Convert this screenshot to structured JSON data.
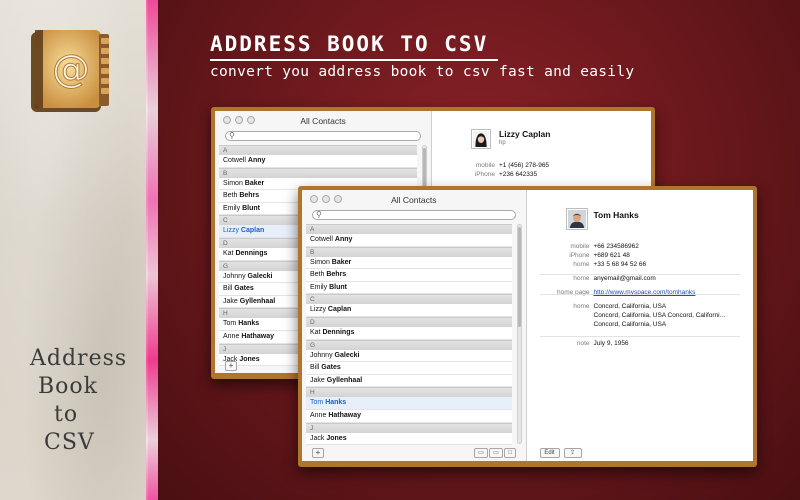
{
  "hero": {
    "title": "Address Book to CSV",
    "subtitle": "convert you address book to csv fast and easily"
  },
  "sidebar": {
    "title_lines": [
      "Address",
      "Book",
      "to",
      "CSV"
    ]
  },
  "back_window": {
    "title": "All Contacts",
    "contacts": [
      {
        "type": "header",
        "label": "A"
      },
      {
        "type": "contact",
        "first": "Cotwell",
        "last": "Anny"
      },
      {
        "type": "header",
        "label": "B"
      },
      {
        "type": "contact",
        "first": "Simon",
        "last": "Baker"
      },
      {
        "type": "contact",
        "first": "Beth",
        "last": "Behrs"
      },
      {
        "type": "contact",
        "first": "Emily",
        "last": "Blunt"
      },
      {
        "type": "header",
        "label": "C"
      },
      {
        "type": "contact",
        "first": "Lizzy",
        "last": "Caplan",
        "selected": true
      },
      {
        "type": "header",
        "label": "D"
      },
      {
        "type": "contact",
        "first": "Kat",
        "last": "Dennings"
      },
      {
        "type": "header",
        "label": "G"
      },
      {
        "type": "contact",
        "first": "Johnny",
        "last": "Galecki"
      },
      {
        "type": "contact",
        "first": "Bill",
        "last": "Gates"
      },
      {
        "type": "contact",
        "first": "Jake",
        "last": "Gyllenhaal"
      },
      {
        "type": "header",
        "label": "H"
      },
      {
        "type": "contact",
        "first": "Tom",
        "last": "Hanks"
      },
      {
        "type": "contact",
        "first": "Anne",
        "last": "Hathaway"
      },
      {
        "type": "header",
        "label": "J"
      },
      {
        "type": "contact",
        "first": "Jack",
        "last": "Jones"
      }
    ],
    "card": {
      "name": "Lizzy  Caplan",
      "sub": "hp",
      "fields": [
        {
          "label": "mobile",
          "value": "+1 (456) 278-965"
        },
        {
          "label": "iPhone",
          "value": "+236 642335"
        }
      ]
    },
    "add_label": "+"
  },
  "front_window": {
    "title": "All Contacts",
    "contacts": [
      {
        "type": "header",
        "label": "A"
      },
      {
        "type": "contact",
        "first": "Cotwell",
        "last": "Anny"
      },
      {
        "type": "header",
        "label": "B"
      },
      {
        "type": "contact",
        "first": "Simon",
        "last": "Baker"
      },
      {
        "type": "contact",
        "first": "Beth",
        "last": "Behrs"
      },
      {
        "type": "contact",
        "first": "Emily",
        "last": "Blunt"
      },
      {
        "type": "header",
        "label": "C"
      },
      {
        "type": "contact",
        "first": "Lizzy",
        "last": "Caplan"
      },
      {
        "type": "header",
        "label": "D"
      },
      {
        "type": "contact",
        "first": "Kat",
        "last": "Dennings"
      },
      {
        "type": "header",
        "label": "G"
      },
      {
        "type": "contact",
        "first": "Johnny",
        "last": "Galecki"
      },
      {
        "type": "contact",
        "first": "Bill",
        "last": "Gates"
      },
      {
        "type": "contact",
        "first": "Jake",
        "last": "Gyllenhaal"
      },
      {
        "type": "header",
        "label": "H"
      },
      {
        "type": "contact",
        "first": "Tom",
        "last": "Hanks",
        "selected": true
      },
      {
        "type": "contact",
        "first": "Anne",
        "last": "Hathaway"
      },
      {
        "type": "header",
        "label": "J"
      },
      {
        "type": "contact",
        "first": "Jack",
        "last": "Jones"
      }
    ],
    "card": {
      "name": "Tom Hanks",
      "fields": [
        {
          "label": "mobile",
          "value": "+66 234586962"
        },
        {
          "label": "iPhone",
          "value": "+689 621 48"
        },
        {
          "label": "home",
          "value": "+33 5 68 94 52 66"
        },
        {
          "label": "home",
          "value": "anyemail@gmail.com"
        },
        {
          "label": "home page",
          "value": "http://www.myspace.com/tomhanks",
          "link": true
        },
        {
          "label": "home",
          "value": "Concord, California, USA"
        },
        {
          "label": "",
          "value": "Concord, California, USA Concord, Californi..."
        },
        {
          "label": "",
          "value": "Concord, California, USA"
        },
        {
          "label": "note",
          "value": "July 9, 1956"
        }
      ]
    },
    "add_label": "+",
    "edit_label": "Edit",
    "share_label": "⇪"
  }
}
